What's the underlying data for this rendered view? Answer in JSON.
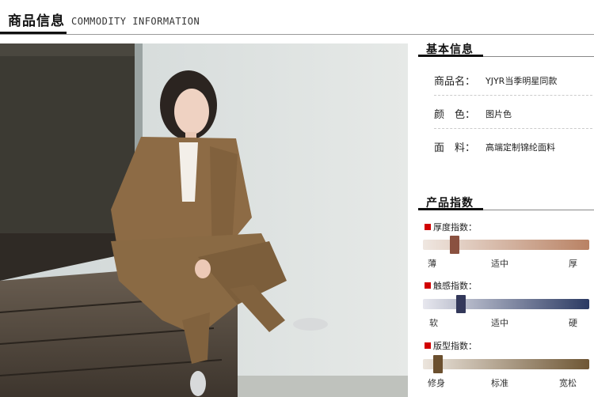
{
  "header": {
    "title_cn": "商品信息",
    "title_en": "COMMODITY INFORMATION"
  },
  "basic_info": {
    "heading": "基本信息",
    "rows": [
      {
        "key": "商品名：",
        "value": "YJYR当季明星同款"
      },
      {
        "key": "颜　色：",
        "value": "图片色"
      },
      {
        "key": "面　料：",
        "value": "高端定制锦纶面料"
      }
    ]
  },
  "product_index": {
    "heading": "产品指数",
    "items": [
      {
        "label": "厚度指数：",
        "level": 0.19,
        "ticks": [
          "薄",
          "适中",
          "厚"
        ],
        "colors": {
          "start": "#efe7e1",
          "end": "#b98264",
          "knob": "#8a5140"
        }
      },
      {
        "label": "触感指数：",
        "level": 0.23,
        "ticks": [
          "软",
          "适中",
          "硬"
        ],
        "colors": {
          "start": "#e7e7ee",
          "end": "#2b3a63",
          "knob": "#33385a"
        }
      },
      {
        "label": "版型指数：",
        "level": 0.09,
        "ticks": [
          "修身",
          "标准",
          "宽松"
        ],
        "colors": {
          "start": "#ece5dd",
          "end": "#6e5634",
          "knob": "#6b4f2e"
        }
      }
    ]
  },
  "image": {
    "subject": "woman-in-khaki-suit-photo"
  },
  "colors": {
    "accent_red": "#d10000",
    "title_black": "#111111"
  }
}
